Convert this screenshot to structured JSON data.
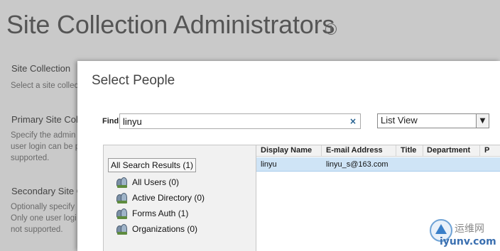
{
  "page": {
    "title": "Site Collection Administrators",
    "sections": [
      {
        "title": "Site Collection",
        "desc": [
          "Select a site collec"
        ]
      },
      {
        "title": "Primary Site Colle",
        "desc": [
          "Specify the admin",
          "user login can be p",
          "supported."
        ]
      },
      {
        "title": "Secondary Site C",
        "desc": [
          "Optionally specify",
          "Only one user logi",
          "not supported."
        ]
      }
    ]
  },
  "dialog": {
    "title": "Select People",
    "find_label": "Find",
    "find_value": "linyu",
    "clear_glyph": "×",
    "view_selected": "List View",
    "tree": {
      "root": "All Search Results (1)",
      "items": [
        {
          "label": "All Users (0)",
          "icon": "users-icon"
        },
        {
          "label": "Active Directory (0)",
          "icon": "users-icon"
        },
        {
          "label": "Forms Auth (1)",
          "icon": "users-icon"
        },
        {
          "label": "Organizations (0)",
          "icon": "users-icon"
        }
      ]
    },
    "results": {
      "columns": [
        "Display Name",
        "E-mail Address",
        "Title",
        "Department",
        "P"
      ],
      "rows": [
        {
          "display_name": "linyu",
          "email": "linyu_s@163.com",
          "title": "",
          "department": ""
        }
      ]
    }
  },
  "watermark": {
    "text": "运维网",
    "url": "iyunv.com"
  },
  "colors": {
    "overlay_bg": "#c9c9c9",
    "selected_row": "#cfe4f6",
    "clear_icon": "#1d5b8c"
  }
}
